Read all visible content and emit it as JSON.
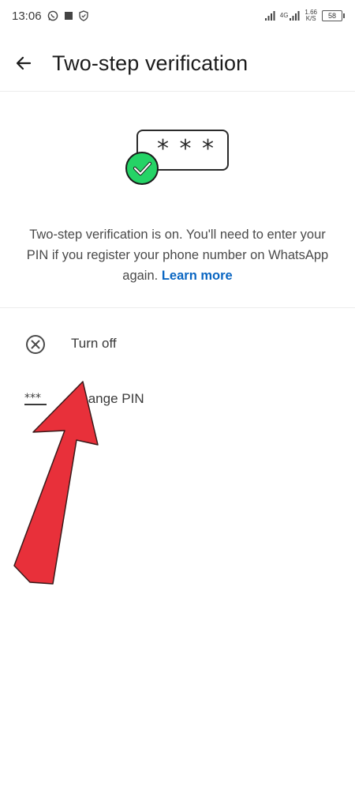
{
  "status_bar": {
    "time": "13:06",
    "network_label": "4G",
    "net_speed_value": "1.66",
    "net_speed_unit": "K/S",
    "battery": "58"
  },
  "app_bar": {
    "title": "Two-step verification"
  },
  "illustration": {
    "pin_mask": "* * *"
  },
  "description": {
    "text": "Two-step verification is on. You'll need to enter your PIN if you register your phone number on WhatsApp again.",
    "link": "Learn more"
  },
  "options": [
    {
      "label": "Turn off",
      "icon": "cancel-circle-icon"
    },
    {
      "label": "Change PIN",
      "icon": "pin-dots-icon"
    }
  ],
  "colors": {
    "accent_link": "#0a66c2",
    "check_green": "#25d366",
    "annotation_arrow": "#e8303a"
  }
}
